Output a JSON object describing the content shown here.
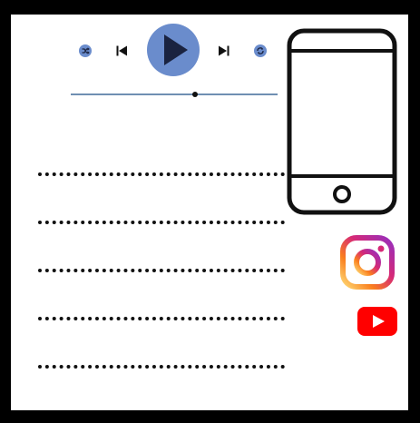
{
  "player": {
    "controls": {
      "shuffle": {
        "icon": "shuffle-icon"
      },
      "previous": {
        "icon": "previous-track-icon"
      },
      "play": {
        "icon": "play-icon"
      },
      "next": {
        "icon": "next-track-icon"
      },
      "repeat": {
        "icon": "repeat-icon"
      }
    },
    "progress": 0.6,
    "colors": {
      "accent": "#6a8ccc",
      "icon_dark": "#1a2340",
      "track": "#6f8fb2"
    }
  },
  "text_lines": [
    {
      "placeholder": "dotted-line"
    },
    {
      "placeholder": "dotted-line"
    },
    {
      "placeholder": "dotted-line"
    },
    {
      "placeholder": "dotted-line"
    },
    {
      "placeholder": "dotted-line"
    }
  ],
  "icons": {
    "phone": "smartphone-icon",
    "instagram": "instagram-icon",
    "youtube": "youtube-icon"
  },
  "colors": {
    "background": "#ffffff",
    "frame": "#000000",
    "youtube_red": "#ff0000"
  }
}
